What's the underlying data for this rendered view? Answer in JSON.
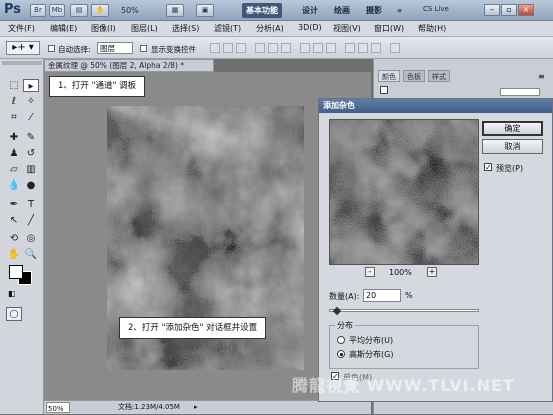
{
  "title_bar": {
    "logo": "Ps",
    "zoom": "50%",
    "workspaces": [
      "基本功能",
      "设计",
      "绘画",
      "摄影"
    ],
    "cs_live": "CS Live"
  },
  "menu": [
    "文件(F)",
    "编辑(E)",
    "图像(I)",
    "图层(L)",
    "选择(S)",
    "滤镜(T)",
    "分析(A)",
    "3D(D)",
    "视图(V)",
    "窗口(W)",
    "帮助(H)"
  ],
  "options_bar": {
    "auto_select_label": "自动选择:",
    "auto_select_value": "图层",
    "show_transform_label": "显示变换控件"
  },
  "document": {
    "tab_title": "金属纹理 @ 50% (图层 2, Alpha 2/8) *",
    "status_zoom": "50%",
    "status_info": "文档:1.23M/4.05M"
  },
  "right_panel": {
    "tabs": [
      "颜色",
      "色板",
      "样式"
    ]
  },
  "callouts": {
    "step1": "1、打开 \"通道\" 调板",
    "step2": "2、打开 \"添加杂色\" 对话框并设置"
  },
  "dialog": {
    "title": "添加杂色",
    "ok_label": "确定",
    "cancel_label": "取消",
    "preview_label": "预览(P)",
    "preview_checked": true,
    "zoom_level": "100%",
    "zoom_out": "-",
    "zoom_in": "+",
    "amount_label": "数量(A):",
    "amount_value": "20",
    "amount_unit": "%",
    "amount_fraction": 0.05,
    "distribution_label": "分布",
    "uniform_label": "平均分布(U)",
    "gaussian_label": "高斯分布(G)",
    "selected_distribution": "gaussian",
    "monochrome_label": "单色(M)",
    "monochrome_checked": true
  },
  "watermark": "腾龍視覺 WWW.TLVI.NET"
}
